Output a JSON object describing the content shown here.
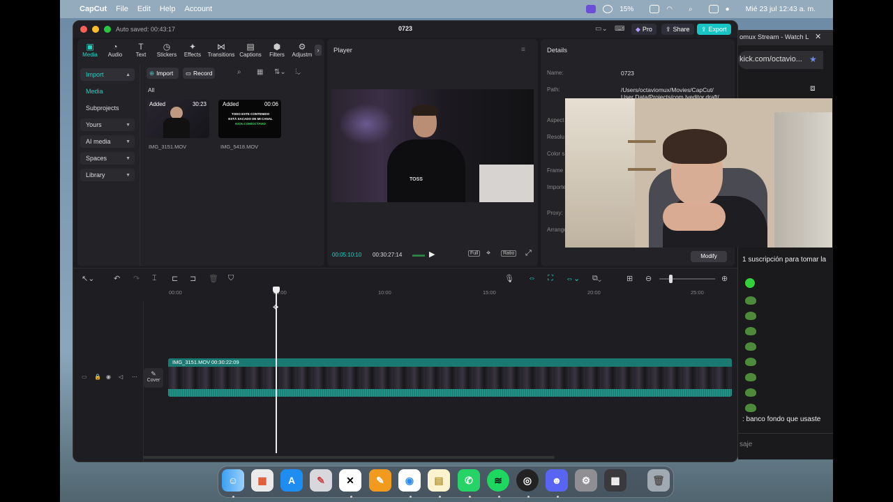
{
  "menubar": {
    "app_name": "CapCut",
    "menus": [
      "File",
      "Edit",
      "Help",
      "Account"
    ],
    "battery": "15%",
    "datetime": "Mié 23 jul  12:43 a. m."
  },
  "window": {
    "auto_saved": "Auto saved: 00:43:17",
    "project_title": "0723",
    "pro_label": "Pro",
    "share_label": "Share",
    "export_label": "Export"
  },
  "toolbar": {
    "tabs": [
      {
        "label": "Media",
        "icon": "media-icon"
      },
      {
        "label": "Audio",
        "icon": "audio-icon"
      },
      {
        "label": "Text",
        "icon": "text-icon"
      },
      {
        "label": "Stickers",
        "icon": "stickers-icon"
      },
      {
        "label": "Effects",
        "icon": "effects-icon"
      },
      {
        "label": "Transitions",
        "icon": "transitions-icon"
      },
      {
        "label": "Captions",
        "icon": "captions-icon"
      },
      {
        "label": "Filters",
        "icon": "filters-icon"
      },
      {
        "label": "Adjustm",
        "icon": "adjust-icon"
      }
    ]
  },
  "sidebar": {
    "items": [
      {
        "label": "Import"
      },
      {
        "label": "Media"
      },
      {
        "label": "Subprojects"
      },
      {
        "label": "Yours"
      },
      {
        "label": "AI media"
      },
      {
        "label": "Spaces"
      },
      {
        "label": "Library"
      }
    ]
  },
  "media": {
    "import_label": "Import",
    "record_label": "Record",
    "filter_all": "All",
    "items": [
      {
        "badge": "Added",
        "duration": "30:23",
        "name": "IMG_3151.MOV"
      },
      {
        "badge": "Added",
        "duration": "00:06",
        "name": "IMG_5418.MOV",
        "overlay_line1": "TODO ESTE CONTENIDO",
        "overlay_line2": "ESTÁ SACADO DE MI CANAL",
        "overlay_link": "KICK.COM/OCTAVIO"
      }
    ]
  },
  "player": {
    "title": "Player",
    "current_time": "00:05:10:10",
    "total_time": "00:30:27:14",
    "full_label": "Full",
    "ratio_label": "Ratio",
    "shirt_text": "TOSS"
  },
  "details": {
    "title": "Details",
    "name_key": "Name:",
    "name_value": "0723",
    "path_key": "Path:",
    "path_line1": "/Users/octaviomux/Movies/CapCut/",
    "path_line2": "User Data/Projects/com.lveditor.draft/",
    "partial_keys": [
      "Aspect",
      "Resolu",
      "Color s",
      "Frame",
      "Importe",
      "Proxy:",
      "Arrange"
    ],
    "modify_label": "Modify"
  },
  "timeline": {
    "ruler": [
      "00:00",
      "05:00",
      "10:00",
      "15:00",
      "20:00",
      "25:00"
    ],
    "clip_name": "IMG_3151.MOV",
    "clip_duration": "00:30:22:09",
    "cover_label": "Cover",
    "zoom_level": 0.18
  },
  "browser": {
    "tab_title": "omux Stream - Watch L",
    "url": "kick.com/octavio...",
    "chat_top": "1 suscripción para tomar la",
    "chat_bottom": ": banco fondo que usaste",
    "chat_input": "saje"
  },
  "dock": {
    "apps": [
      "finder-icon",
      "launchpad-icon",
      "app-store-icon",
      "notes-pencil-icon",
      "capcut-icon",
      "pages-icon",
      "chrome-icon",
      "notes-icon",
      "whatsapp-icon",
      "spotify-icon",
      "obs-icon",
      "discord-icon",
      "settings-icon",
      "calculator-icon",
      "trash-icon"
    ]
  },
  "colors": {
    "accent": "#20d4c8",
    "export": "#16c5c4",
    "clip": "#1a7a72"
  }
}
